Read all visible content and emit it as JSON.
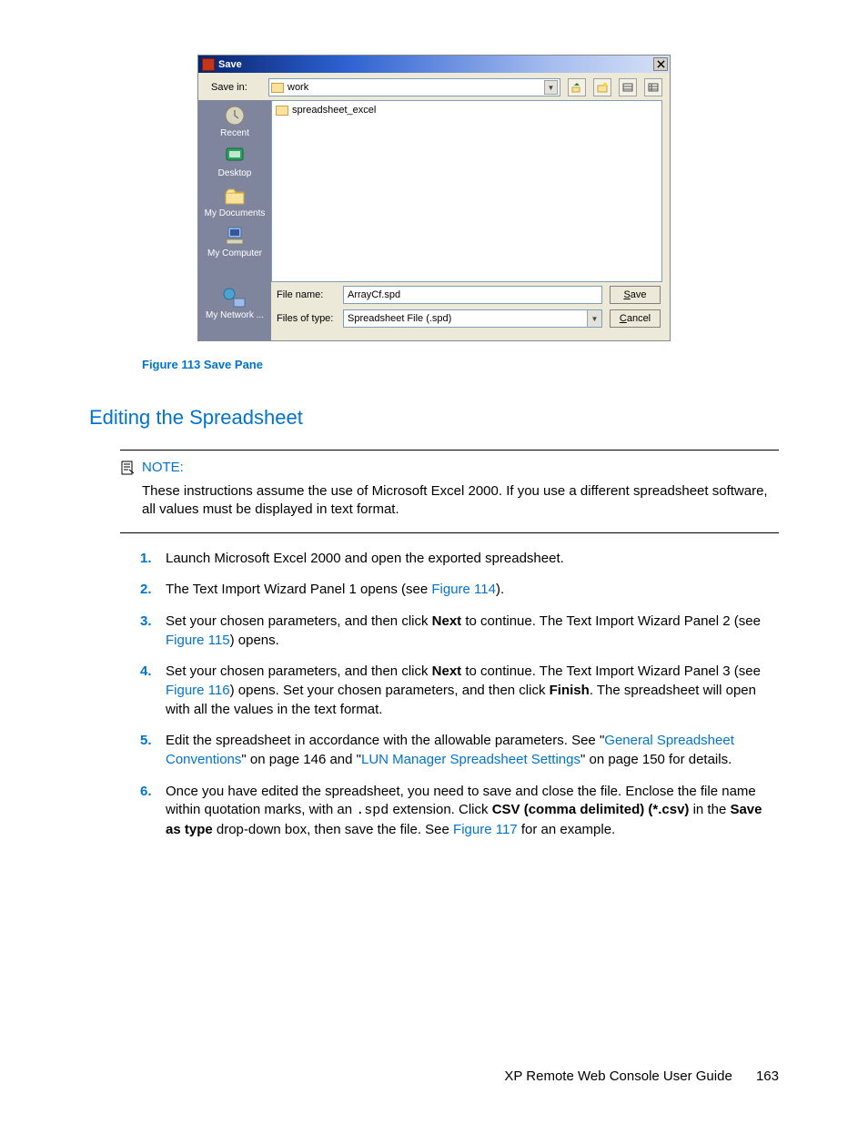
{
  "dialog": {
    "title": "Save",
    "save_in_label": "Save in:",
    "save_in_value": "work",
    "file_entry": "spreadsheet_excel",
    "places": {
      "recent": "Recent",
      "desktop": "Desktop",
      "mydocs": "My Documents",
      "mycomp": "My Computer",
      "mynet": "My Network ..."
    },
    "file_name_label": "File name:",
    "file_name_value": "ArrayCf.spd",
    "file_type_label": "Files of type:",
    "file_type_value": "Spreadsheet File (.spd)",
    "save_btn": "Save",
    "cancel_btn": "Cancel"
  },
  "fig_caption": "Figure 113 Save Pane",
  "heading": "Editing the Spreadsheet",
  "note": {
    "title": "NOTE:",
    "body": "These instructions assume the use of Microsoft Excel 2000. If you use a different spreadsheet software, all values must be displayed in text format."
  },
  "steps": {
    "s1": "Launch Microsoft Excel 2000 and open the exported spreadsheet.",
    "s2a": "The Text Import Wizard Panel 1 opens (see ",
    "s2link": "Figure 114",
    "s2b": ").",
    "s3a": "Set your chosen parameters, and then click ",
    "s3bold": "Next",
    "s3b": " to continue. The Text Import Wizard Panel 2 (see ",
    "s3link": "Figure 115",
    "s3c": ") opens.",
    "s4a": "Set your chosen parameters, and then click ",
    "s4bold1": "Next",
    "s4b": " to continue. The Text Import Wizard Panel 3 (see ",
    "s4link": "Figure 116",
    "s4c": ") opens. Set your chosen parameters, and then click ",
    "s4bold2": "Finish",
    "s4d": ". The spreadsheet will open with all the values in the text format.",
    "s5a": "Edit the spreadsheet in accordance with the allowable parameters. See \"",
    "s5link1": "General Spreadsheet Conventions",
    "s5b": "\" on page 146 and \"",
    "s5link2": "LUN Manager Spreadsheet Settings",
    "s5c": "\" on page 150 for details.",
    "s6a": "Once you have edited the spreadsheet, you need to save and close the file. Enclose the file name within quotation marks, with an ",
    "s6mono": ".spd",
    "s6b": " extension. Click ",
    "s6bold1": "CSV (comma delimited) (*.csv)",
    "s6c": " in the ",
    "s6bold2": "Save as type",
    "s6d": " drop-down box, then save the file. See ",
    "s6link": "Figure 117",
    "s6e": " for an example."
  },
  "footer": {
    "title": "XP Remote Web Console User Guide",
    "page": "163"
  }
}
